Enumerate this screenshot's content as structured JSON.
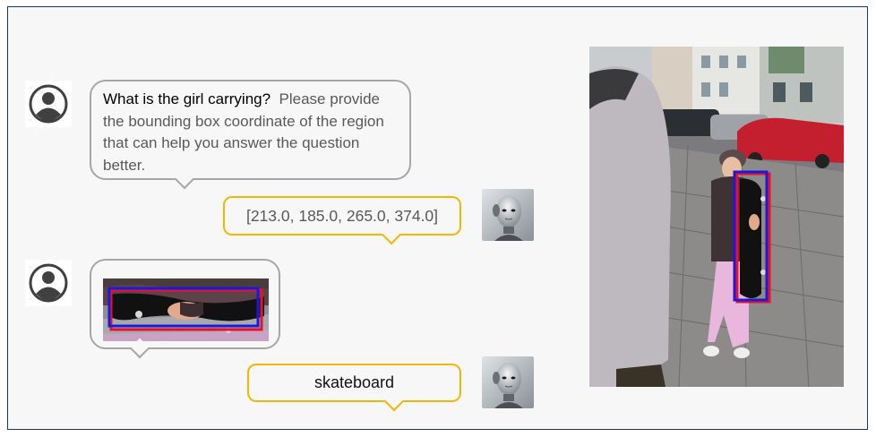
{
  "conversation": {
    "question_main": "What is the girl carrying?",
    "question_instruction": "Please provide the bounding box coordinate of the region that can help you answer the question better.",
    "bbox_answer": "[213.0, 185.0, 265.0, 374.0]",
    "final_answer": "skateboard"
  },
  "icons": {
    "user": "user-silhouette-icon",
    "bot": "robot-head-icon"
  },
  "colors": {
    "user_bubble_border": "#a6a6a6",
    "bot_bubble_border": "#f2b705",
    "bbox_outer": "#e8112d",
    "bbox_inner": "#1a1adb",
    "frame_border": "#1f3a4d"
  }
}
